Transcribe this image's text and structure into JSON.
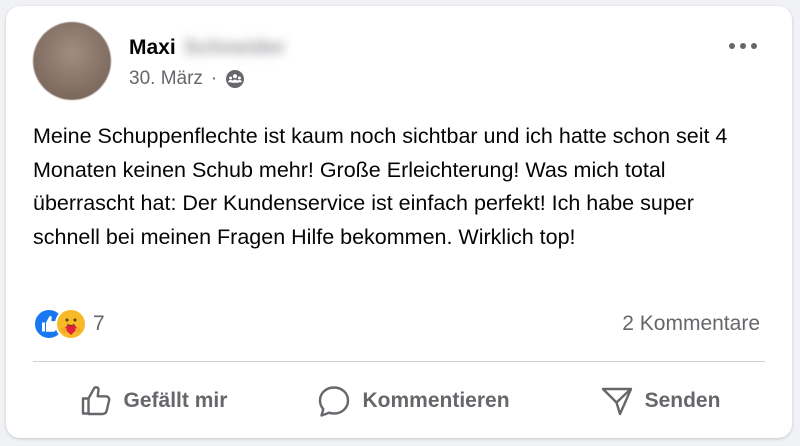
{
  "post": {
    "author_first_name": "Maxi",
    "author_last_name": "Schneider",
    "date": "30. März",
    "separator": "·",
    "audience_icon": "friends-icon",
    "more_icon": "more-horizontal-icon",
    "text": "Meine Schuppenflechte ist kaum noch sichtbar und ich hatte schon seit 4 Monaten keinen Schub mehr! Große Erleichterung! Was mich total überrascht hat: Der Kundenservice ist einfach perfekt! Ich habe super schnell bei meinen Fragen Hilfe bekommen. Wirklich top!"
  },
  "reactions": {
    "icons": [
      "like-icon",
      "care-icon"
    ],
    "count": "7",
    "comments": "2 Kommentare"
  },
  "actions": {
    "like_label": "Gefällt mir",
    "comment_label": "Kommentieren",
    "send_label": "Senden"
  },
  "colors": {
    "like_blue": "#1877f2",
    "care_yellow": "#f7b928",
    "care_red": "#e41e3f",
    "secondary_text": "#65676b",
    "primary_text": "#050505"
  }
}
